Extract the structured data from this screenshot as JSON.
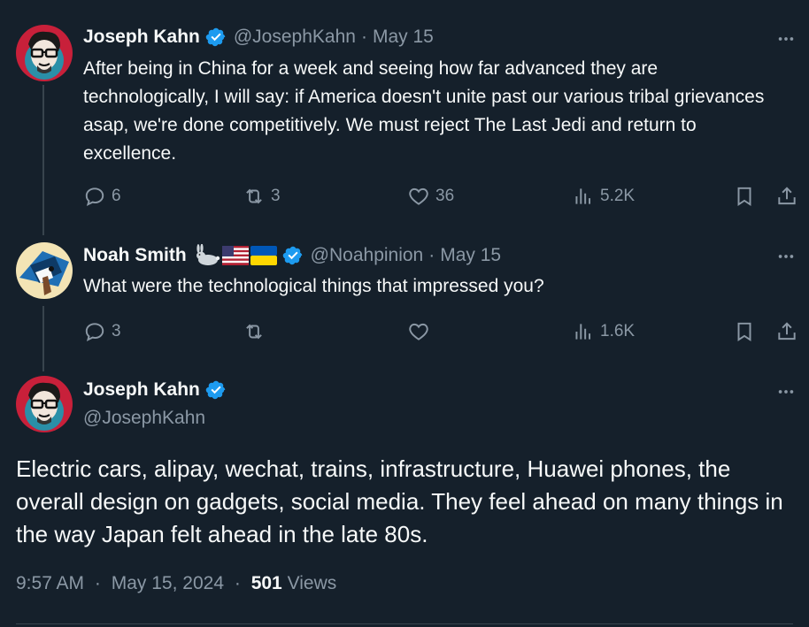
{
  "tweets": [
    {
      "name": "Joseph Kahn",
      "handle": "@JosephKahn",
      "date": "May 15",
      "text": "After being in China for a week and seeing how far advanced they are technologically, I will say: if America doesn't unite past our various tribal grievances asap, we're done competitively. We must reject The Last Jedi and return to excellence.",
      "replies": "6",
      "retweets": "3",
      "likes": "36",
      "views": "5.2K"
    },
    {
      "name": "Noah Smith",
      "name_emojis": [
        "rabbit",
        "us-flag",
        "ukraine-flag"
      ],
      "handle": "@Noahpinion",
      "date": "May 15",
      "text": "What were the technological things that impressed you?",
      "replies": "3",
      "retweets": "",
      "likes": "",
      "views": "1.6K"
    }
  ],
  "main": {
    "name": "Joseph Kahn",
    "handle": "@JosephKahn",
    "text": "Electric cars, alipay, wechat, trains, infrastructure, Huawei phones, the overall design on gadgets, social media. They feel ahead on many things in the way Japan felt ahead in the late 80s.",
    "time": "9:57 AM",
    "date": "May 15, 2024",
    "views_count": "501",
    "views_label": "Views"
  },
  "separator": "·",
  "colors": {
    "background": "#15202b",
    "text": "#f7f9f9",
    "secondary": "#8b98a5",
    "verified": "#1d9bf0",
    "thread_line": "#38444d"
  }
}
